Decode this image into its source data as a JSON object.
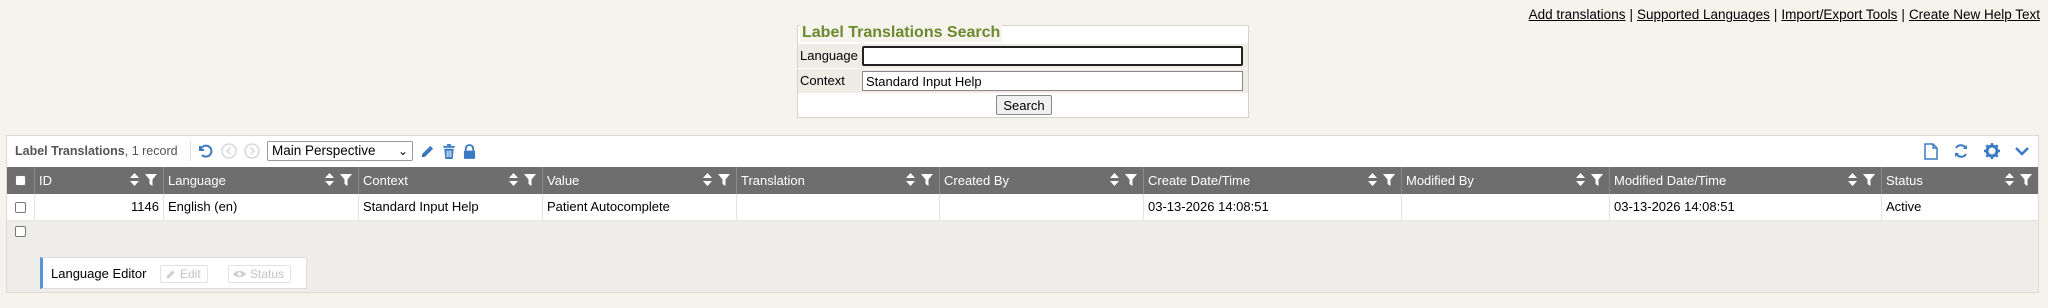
{
  "top_links": [
    "Add translations",
    "Supported Languages",
    "Import/Export Tools",
    "Create New Help Text"
  ],
  "search": {
    "title": "Label Translations Search",
    "language_label": "Language",
    "language_value": "",
    "context_label": "Context",
    "context_value": "Standard Input Help",
    "button_label": "Search"
  },
  "grid": {
    "title": "Label Translations",
    "record_count": ", 1 record",
    "perspective": "Main Perspective",
    "columns": [
      "ID",
      "Language",
      "Context",
      "Value",
      "Translation",
      "Created By",
      "Create Date/Time",
      "Modified By",
      "Modified Date/Time",
      "Status"
    ],
    "rows": [
      {
        "id": "1146",
        "language": "English (en)",
        "context": "Standard Input Help",
        "value": "Patient Autocomplete",
        "translation": "",
        "created_by": "",
        "create_datetime": "03-13-2026 14:08:51",
        "modified_by": "",
        "modified_datetime": "03-13-2026 14:08:51",
        "status": "Active"
      }
    ]
  },
  "editor": {
    "title": "Language Editor",
    "edit_label": "Edit",
    "status_label": "Status"
  },
  "colors": {
    "accent": "#6b8a2f",
    "icon_blue": "#3a7ac2",
    "header_bg": "#6e6e6e"
  },
  "icons": [
    "undo-icon",
    "back-icon",
    "forward-icon",
    "pencil-icon",
    "trash-icon",
    "lock-icon",
    "document-icon",
    "refresh-icon",
    "gear-icon",
    "chevron-down-icon",
    "sort-icon",
    "filter-icon",
    "eye-icon"
  ]
}
